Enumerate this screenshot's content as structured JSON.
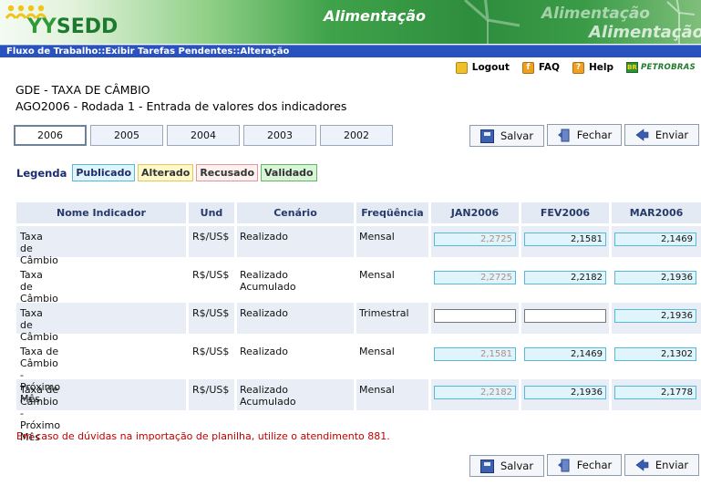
{
  "header": {
    "logo_text": "SEDD",
    "app_title": "Alimentação",
    "ghost_title_1": "Alimentação",
    "ghost_title_2": "Alimentação"
  },
  "breadcrumb": "Fluxo de Trabalho::Exibir Tarefas Pendentes::Alteração",
  "top_links": {
    "logout": "Logout",
    "faq": "FAQ",
    "help": "Help",
    "brand": "PETROBRAS"
  },
  "page": {
    "title": "GDE - TAXA DE CÂMBIO",
    "subtitle": "AGO2006 - Rodada 1 - Entrada de valores dos indicadores"
  },
  "year_tabs": [
    "2006",
    "2005",
    "2004",
    "2003",
    "2002"
  ],
  "active_tab": "2006",
  "buttons": {
    "save": "Salvar",
    "close": "Fechar",
    "send": "Enviar"
  },
  "legend": {
    "label": "Legenda",
    "items": [
      "Publicado",
      "Alterado",
      "Recusado",
      "Validado"
    ]
  },
  "table": {
    "columns": [
      "Nome Indicador",
      "Und",
      "Cenário",
      "Freqüência",
      "JAN2006",
      "FEV2006",
      "MAR2006"
    ],
    "rows": [
      {
        "name": "Taxa de Câmbio",
        "unit": "R$/US$",
        "scenario": "Realizado",
        "freq": "Mensal",
        "jan": "2,2725",
        "fev": "2,1581",
        "mar": "2,1469"
      },
      {
        "name": "Taxa de Câmbio",
        "unit": "R$/US$",
        "scenario": "Realizado Acumulado",
        "freq": "Mensal",
        "jan": "2,2725",
        "fev": "2,2182",
        "mar": "2,1936"
      },
      {
        "name": "Taxa de Câmbio",
        "unit": "R$/US$",
        "scenario": "Realizado",
        "freq": "Trimestral",
        "jan": "",
        "fev": "",
        "mar": "2,1936"
      },
      {
        "name": "Taxa de Câmbio - Próximo Mês",
        "unit": "R$/US$",
        "scenario": "Realizado",
        "freq": "Mensal",
        "jan": "2,1581",
        "fev": "2,1469",
        "mar": "2,1302"
      },
      {
        "name": "Taxa de Câmbio - Próximo Mês",
        "unit": "R$/US$",
        "scenario": "Realizado Acumulado",
        "freq": "Mensal",
        "jan": "2,2182",
        "fev": "2,1936",
        "mar": "2,1778"
      }
    ]
  },
  "note": "Em caso de dúvidas na importação de planilha, utilize o atendimento 881.",
  "colors": {
    "breadcrumb_bg": "#2a52be",
    "published": "#e0f5fb",
    "note_text": "#c00000"
  }
}
